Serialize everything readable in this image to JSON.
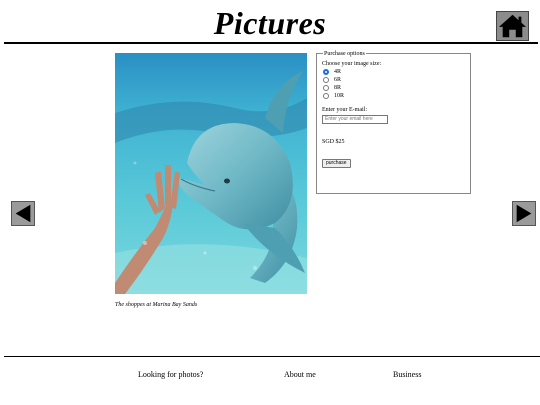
{
  "header": {
    "title": "Pictures",
    "home_icon": "house-icon"
  },
  "navigation": {
    "prev_icon": "left-arrow-icon",
    "next_icon": "right-arrow-icon"
  },
  "photo": {
    "caption": "The shoppes at Marina Bay Sands",
    "subject": "dolphin-photo"
  },
  "purchase": {
    "legend": "Purchase options",
    "size_label": "Choose your image size:",
    "sizes": [
      {
        "label": "4R",
        "selected": true
      },
      {
        "label": "6R",
        "selected": false
      },
      {
        "label": "8R",
        "selected": false
      },
      {
        "label": "10R",
        "selected": false
      }
    ],
    "email_label": "Enter your E-mail:",
    "email_placeholder": "Enter your email here",
    "price": "SGD $25",
    "button_label": "purchase"
  },
  "footer": {
    "links": [
      "Looking for photos?",
      "About me",
      "Business"
    ]
  },
  "colors": {
    "nav_button_bg": "#9a9a9a",
    "radio_selected": "#1a6fd6",
    "water": "#3fb2d2"
  }
}
